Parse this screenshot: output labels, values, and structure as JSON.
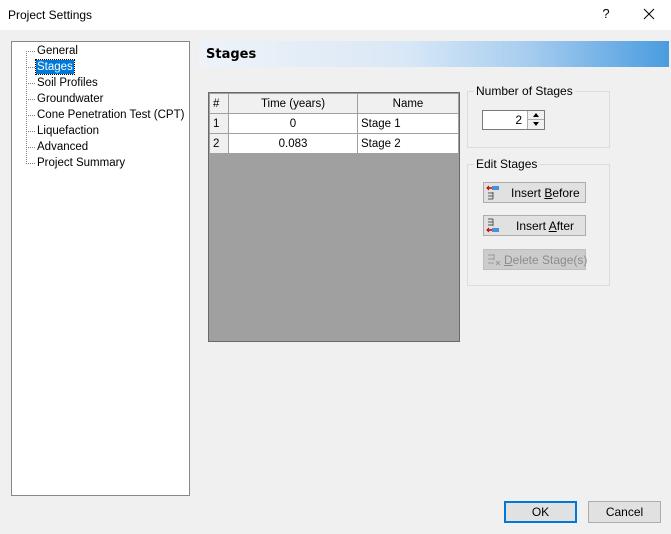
{
  "window": {
    "title": "Project Settings",
    "help_glyph": "?",
    "close_icon": "close-icon"
  },
  "sidebar": {
    "selected": "Stages",
    "items": [
      {
        "label": "General"
      },
      {
        "label": "Stages"
      },
      {
        "label": "Soil Profiles"
      },
      {
        "label": "Groundwater"
      },
      {
        "label": "Cone Penetration Test (CPT)"
      },
      {
        "label": "Liquefaction"
      },
      {
        "label": "Advanced"
      },
      {
        "label": "Project Summary"
      }
    ]
  },
  "panel": {
    "title": "Stages",
    "header_gradient": [
      "#eef3f9",
      "#4a9cdf"
    ]
  },
  "stages_table": {
    "columns": [
      "#",
      "Time (years)",
      "Name"
    ],
    "rows": [
      {
        "num": "1",
        "time": "0",
        "name": "Stage 1"
      },
      {
        "num": "2",
        "time": "0.083",
        "name": "Stage 2"
      }
    ]
  },
  "number_of_stages": {
    "label": "Number of Stages",
    "value": "2"
  },
  "edit_stages": {
    "label": "Edit Stages",
    "insert_before": {
      "pre": "Insert ",
      "mnemonic": "B",
      "post": "efore",
      "icon": "insert-before-icon",
      "enabled": true
    },
    "insert_after": {
      "pre": "Insert ",
      "mnemonic": "A",
      "post": "fter",
      "icon": "insert-after-icon",
      "enabled": true
    },
    "delete": {
      "pre": "",
      "mnemonic": "D",
      "post": "elete Stage(s)",
      "icon": "delete-stage-icon",
      "enabled": false
    }
  },
  "footer": {
    "ok_label": "OK",
    "cancel_label": "Cancel"
  },
  "colors": {
    "selection": "#0078d7",
    "grid_empty": "#a0a0a0"
  }
}
